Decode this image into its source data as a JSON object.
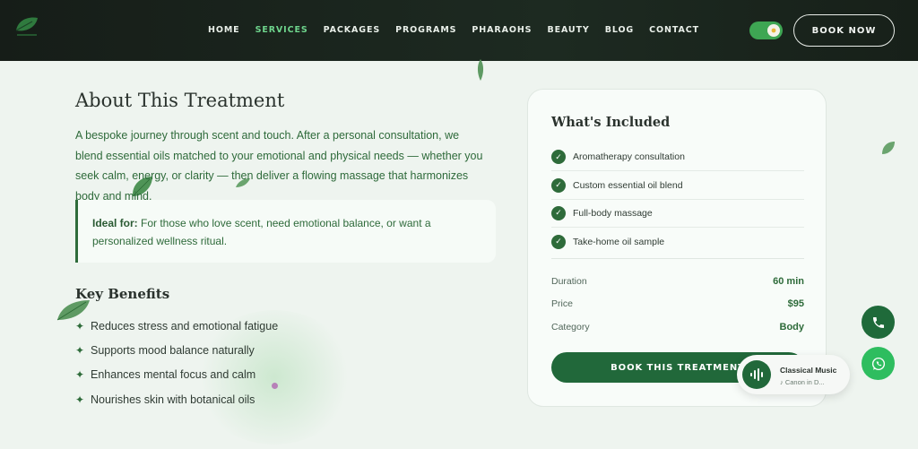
{
  "nav": {
    "items": [
      {
        "label": "HOME",
        "active": false
      },
      {
        "label": "SERVICES",
        "active": true
      },
      {
        "label": "PACKAGES",
        "active": false
      },
      {
        "label": "PROGRAMS",
        "active": false
      },
      {
        "label": "PHARAOHS",
        "active": false
      },
      {
        "label": "BEAUTY",
        "active": false
      },
      {
        "label": "BLOG",
        "active": false
      },
      {
        "label": "CONTACT",
        "active": false
      }
    ],
    "book_now": "BOOK NOW",
    "theme_toggle_on": true
  },
  "main": {
    "title": "About This Treatment",
    "description": "A bespoke journey through scent and touch. After a personal consultation, we blend essential oils matched to your emotional and physical needs — whether you seek calm, energy, or clarity — then deliver a flowing massage that harmonizes body and mind.",
    "ideal_label": "Ideal for:",
    "ideal_text": " For those who love scent, need emotional balance, or want a personalized wellness ritual.",
    "benefits_title": "Key Benefits",
    "benefits": [
      "Reduces stress and emotional fatigue",
      "Supports mood balance naturally",
      "Enhances mental focus and calm",
      "Nourishes skin with botanical oils"
    ]
  },
  "card": {
    "title": "What's Included",
    "included": [
      "Aromatherapy consultation",
      "Custom essential oil blend",
      "Full-body massage",
      "Take-home oil sample"
    ],
    "meta": [
      {
        "label": "Duration",
        "value": "60 min"
      },
      {
        "label": "Price",
        "value": "$95"
      },
      {
        "label": "Category",
        "value": "Body"
      }
    ],
    "button": "BOOK THIS TREATMENT"
  },
  "music": {
    "title": "Classical Music",
    "subtitle": "♪ Canon in D..."
  },
  "colors": {
    "accent": "#21683a",
    "active_nav": "#6ed48c",
    "whatsapp": "#2ebd5f"
  }
}
